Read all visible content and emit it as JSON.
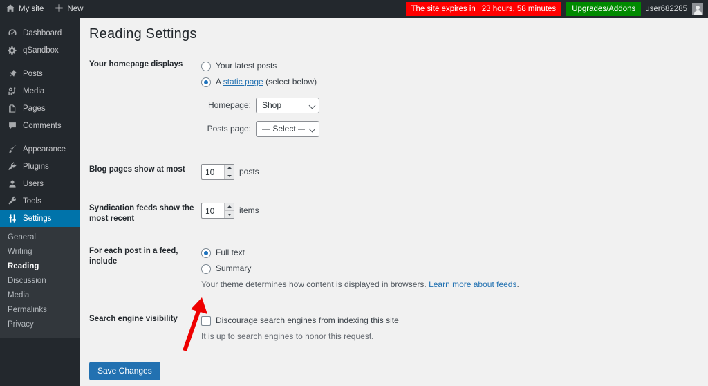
{
  "adminbar": {
    "site_icon": "home-icon",
    "site_label": "My site",
    "new_icon": "plus-icon",
    "new_label": "New",
    "expire_prefix": "The site expires in",
    "expire_time": "23 hours, 58 minutes",
    "upgrades_label": "Upgrades/Addons",
    "username": "user682285",
    "avatar_icon": "user-avatar-icon",
    "expire_bg": "#ff0000",
    "upgrade_bg": "#008a00",
    "bar_bg": "#23282d"
  },
  "sidebar": {
    "active_color": "#0073aa",
    "items": [
      {
        "label": "Dashboard",
        "icon": "dashboard-gauge-icon",
        "active": false
      },
      {
        "label": "qSandbox",
        "icon": "gear-icon",
        "active": false
      },
      {
        "label": "Posts",
        "icon": "pin-icon",
        "active": false
      },
      {
        "label": "Media",
        "icon": "media-note-icon",
        "active": false
      },
      {
        "label": "Pages",
        "icon": "pages-icon",
        "active": false
      },
      {
        "label": "Comments",
        "icon": "comment-bubble-icon",
        "active": false
      },
      {
        "label": "Appearance",
        "icon": "paintbrush-icon",
        "active": false
      },
      {
        "label": "Plugins",
        "icon": "plug-icon",
        "active": false
      },
      {
        "label": "Users",
        "icon": "user-icon",
        "active": false
      },
      {
        "label": "Tools",
        "icon": "wrench-icon",
        "active": false
      },
      {
        "label": "Settings",
        "icon": "sliders-icon",
        "active": true
      }
    ],
    "submenu": [
      {
        "label": "General",
        "current": false
      },
      {
        "label": "Writing",
        "current": false
      },
      {
        "label": "Reading",
        "current": true
      },
      {
        "label": "Discussion",
        "current": false
      },
      {
        "label": "Media",
        "current": false
      },
      {
        "label": "Permalinks",
        "current": false
      },
      {
        "label": "Privacy",
        "current": false
      }
    ]
  },
  "page": {
    "title": "Reading Settings"
  },
  "homepage_displays": {
    "label": "Your homepage displays",
    "option_latest": "Your latest posts",
    "option_static_prefix": "A ",
    "option_static_link": "static page",
    "option_static_suffix": " (select below)",
    "selected": "static",
    "homepage_label": "Homepage:",
    "homepage_value": "Shop",
    "homepage_options": [
      "Shop",
      "— Select —"
    ],
    "posts_page_label": "Posts page:",
    "posts_page_value": "— Select —",
    "posts_page_options": [
      "— Select —",
      "Shop"
    ]
  },
  "blog_pages": {
    "label": "Blog pages show at most",
    "value": "10",
    "unit": "posts"
  },
  "syndication": {
    "label": "Syndication feeds show the most recent",
    "value": "10",
    "unit": "items"
  },
  "feed_include": {
    "label": "For each post in a feed, include",
    "option_full": "Full text",
    "option_summary": "Summary",
    "selected": "full",
    "hint_text": "Your theme determines how content is displayed in browsers. ",
    "hint_link": "Learn more about feeds",
    "hint_suffix": "."
  },
  "search_visibility": {
    "label": "Search engine visibility",
    "checkbox_label": "Discourage search engines from indexing this site",
    "checked": false,
    "hint": "It is up to search engines to honor this request."
  },
  "submit": {
    "save_label": "Save Changes",
    "button_color": "#2271b1"
  },
  "annotation": {
    "arrow_color": "#ee0000",
    "points_to": "discourage-search-engines-checkbox"
  }
}
